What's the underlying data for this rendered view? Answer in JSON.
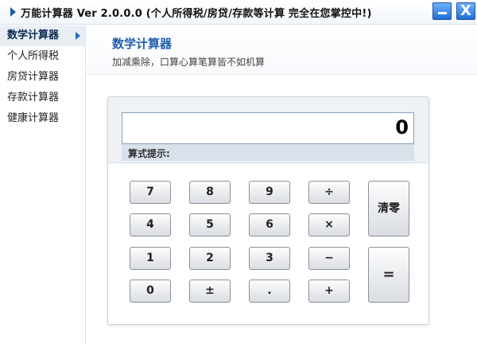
{
  "window": {
    "title": "万能计算器 Ver 2.0.0.0 (个人所得税/房贷/存款等计算 完全在您掌控中!)",
    "close_symbol": "X"
  },
  "sidebar": {
    "items": [
      {
        "label": "数学计算器",
        "active": true
      },
      {
        "label": "个人所得税",
        "active": false
      },
      {
        "label": "房贷计算器",
        "active": false
      },
      {
        "label": "存款计算器",
        "active": false
      },
      {
        "label": "健康计算器",
        "active": false
      }
    ]
  },
  "header": {
    "title": "数学计算器",
    "subtitle": "加减乘除，口算心算笔算皆不如机算"
  },
  "calculator": {
    "display_value": "0",
    "hint_label": "算式提示:",
    "keys": {
      "k7": "7",
      "k8": "8",
      "k9": "9",
      "div": "÷",
      "k4": "4",
      "k5": "5",
      "k6": "6",
      "mul": "×",
      "k1": "1",
      "k2": "2",
      "k3": "3",
      "sub": "−",
      "k0": "0",
      "sign": "±",
      "dot": ".",
      "add": "+",
      "clear": "清零",
      "equals": "="
    }
  },
  "colors": {
    "accent": "#1f5fae",
    "window_button": "#1f6fd6"
  }
}
